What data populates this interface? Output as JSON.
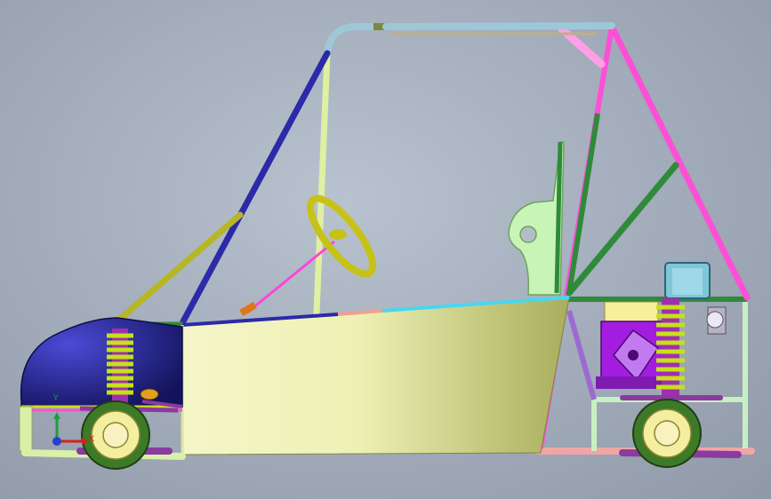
{
  "viewport": {
    "triad": {
      "y_label": "Y",
      "x_label": "X",
      "y_color": "#1f9d3a",
      "x_color": "#d8201c",
      "origin_color": "#2a3fcf"
    }
  },
  "model": {
    "colors": {
      "background": "#a5afbd",
      "nose_shell": "#1d1d7c",
      "side_panel": "#eaeeb8",
      "side_panel_shadow": "#a7ad5b",
      "roll_hoop_vertical": "#dff0a0",
      "front_brace": "#2b2aa8",
      "nose_brace": "#b7b624",
      "roof_tube": "#9ec8d8",
      "rear_brace": "#ff4fd6",
      "green_tube": "#2f8a3a",
      "wheel_rim": "#f3eea0",
      "tyre": "#3d7a28",
      "shock_spring": "#c7e01a",
      "shock_body": "#a02fb0",
      "engine": "#a21de0",
      "fuel_tank": "#7fc6d8"
    }
  }
}
